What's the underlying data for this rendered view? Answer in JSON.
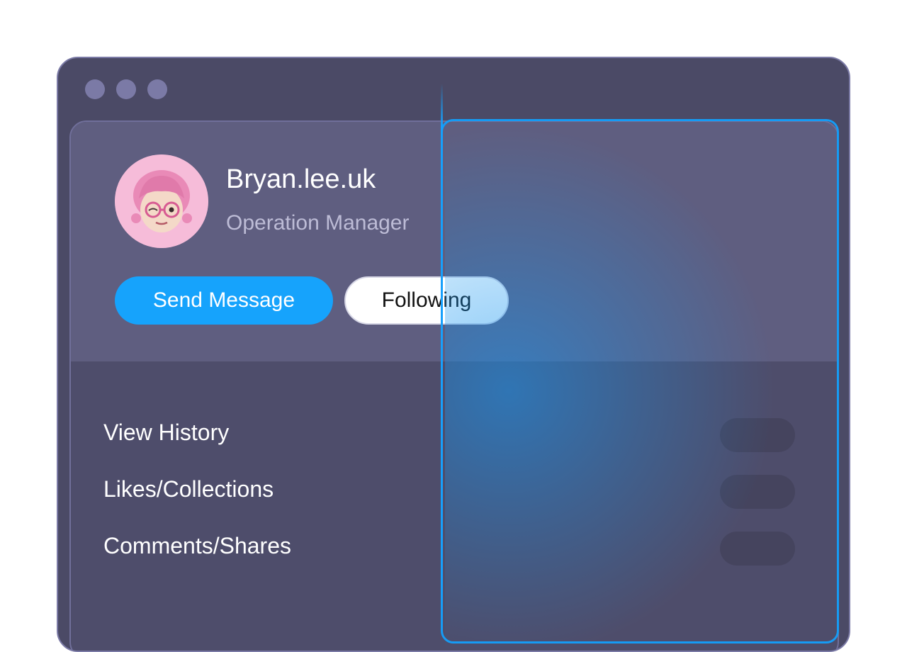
{
  "profile": {
    "name": "Bryan.lee.uk",
    "role": "Operation Manager"
  },
  "actions": {
    "send_message": "Send Message",
    "following": "Following"
  },
  "menu": {
    "items": [
      {
        "label": "View History"
      },
      {
        "label": "Likes/Collections"
      },
      {
        "label": "Comments/Shares"
      }
    ]
  },
  "colors": {
    "accent": "#16a3fc",
    "window_bg": "#4b4a66",
    "panel_top_bg": "#5f5e80"
  }
}
